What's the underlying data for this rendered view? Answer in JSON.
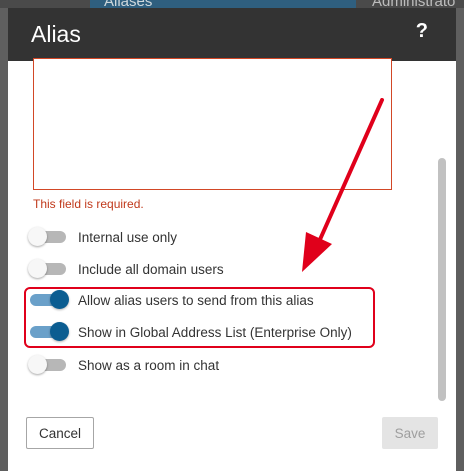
{
  "background": {
    "tabs": [
      {
        "label": "Aliases",
        "active": true
      },
      {
        "label": "Administrato",
        "active": false
      }
    ]
  },
  "dialog": {
    "title": "Alias",
    "help_label": "?",
    "textarea_value": "",
    "error_message": "This field is required.",
    "toggles": [
      {
        "label": "Internal use only",
        "on": false
      },
      {
        "label": "Include all domain users",
        "on": false
      },
      {
        "label": "Allow alias users to send from this alias",
        "on": true
      },
      {
        "label": "Show in Global Address List (Enterprise Only)",
        "on": true
      },
      {
        "label": "Show as a room in chat",
        "on": false
      }
    ],
    "cancel_label": "Cancel",
    "save_label": "Save"
  },
  "colors": {
    "header_bg": "#333333",
    "toggle_on": "#0b5d91",
    "toggle_off": "#b7b7b7",
    "error": "#c0391b",
    "annotation": "#e0001b"
  }
}
